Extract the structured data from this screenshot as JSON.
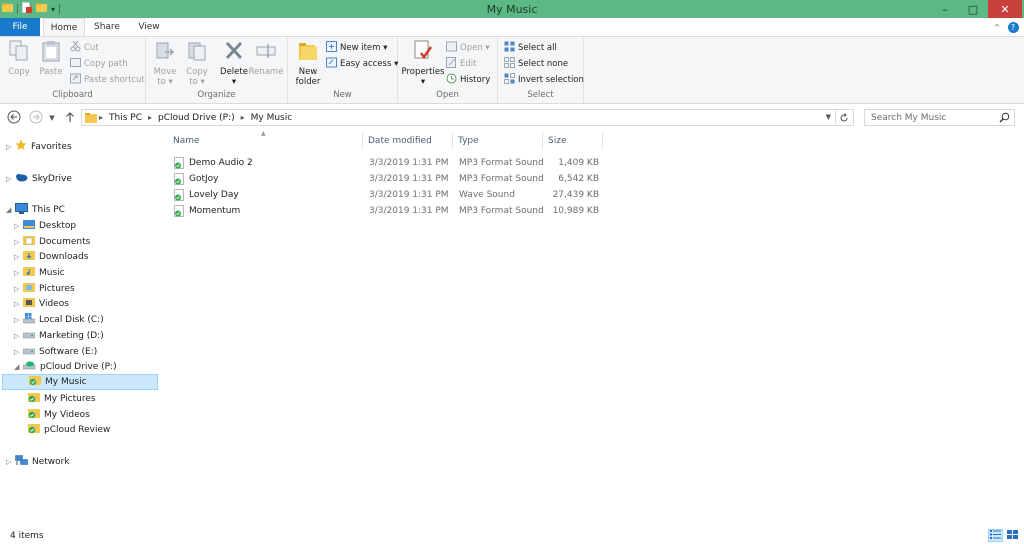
{
  "window": {
    "title": "My Music",
    "minimize": "–",
    "maximize": "□",
    "close": "✕",
    "help": "?",
    "collapse": "^"
  },
  "tabs": {
    "file": "File",
    "home": "Home",
    "share": "Share",
    "view": "View"
  },
  "ribbon": {
    "clipboard": {
      "label": "Clipboard",
      "copy": "Copy",
      "paste": "Paste",
      "cut": "Cut",
      "copy_path": "Copy path",
      "paste_shortcut": "Paste shortcut"
    },
    "organize": {
      "label": "Organize",
      "move_to": "Move",
      "move_to2": "to",
      "copy_to": "Copy",
      "copy_to2": "to",
      "delete": "Delete",
      "rename": "Rename"
    },
    "new": {
      "label": "New",
      "new_folder": "New",
      "new_folder2": "folder",
      "new_item": "New item",
      "easy_access": "Easy access"
    },
    "open": {
      "label": "Open",
      "properties": "Properties",
      "open": "Open",
      "edit": "Edit",
      "history": "History"
    },
    "select": {
      "label": "Select",
      "select_all": "Select all",
      "select_none": "Select none",
      "invert_selection": "Invert selection"
    }
  },
  "address": {
    "crumbs": [
      "This PC",
      "pCloud Drive (P:)",
      "My Music"
    ],
    "search_placeholder": "Search My Music"
  },
  "nav": {
    "favorites": "Favorites",
    "skydrive": "SkyDrive",
    "this_pc": "This PC",
    "desktop": "Desktop",
    "documents": "Documents",
    "downloads": "Downloads",
    "music": "Music",
    "pictures": "Pictures",
    "videos": "Videos",
    "local_disk": "Local Disk (C:)",
    "marketing": "Marketing (D:)",
    "software": "Software (E:)",
    "pcloud": "pCloud Drive (P:)",
    "my_music": "My Music",
    "my_pictures": "My Pictures",
    "my_videos": "My Videos",
    "pcloud_review": "pCloud Review",
    "network": "Network"
  },
  "columns": {
    "name": "Name",
    "date": "Date modified",
    "type": "Type",
    "size": "Size"
  },
  "files": [
    {
      "name": "Demo Audio 2",
      "date": "3/3/2019 1:31 PM",
      "type": "MP3 Format Sound",
      "size": "1,409 KB"
    },
    {
      "name": "GotJoy",
      "date": "3/3/2019 1:31 PM",
      "type": "MP3 Format Sound",
      "size": "6,542 KB"
    },
    {
      "name": "Lovely Day",
      "date": "3/3/2019 1:31 PM",
      "type": "Wave Sound",
      "size": "27,439 KB"
    },
    {
      "name": "Momentum",
      "date": "3/3/2019 1:31 PM",
      "type": "MP3 Format Sound",
      "size": "10,989 KB"
    }
  ],
  "status": {
    "items": "4 items"
  },
  "colors": {
    "titlebar": "#5cb884",
    "file_tab": "#1979ca",
    "selection": "#cce8ff",
    "close": "#c7403b"
  }
}
